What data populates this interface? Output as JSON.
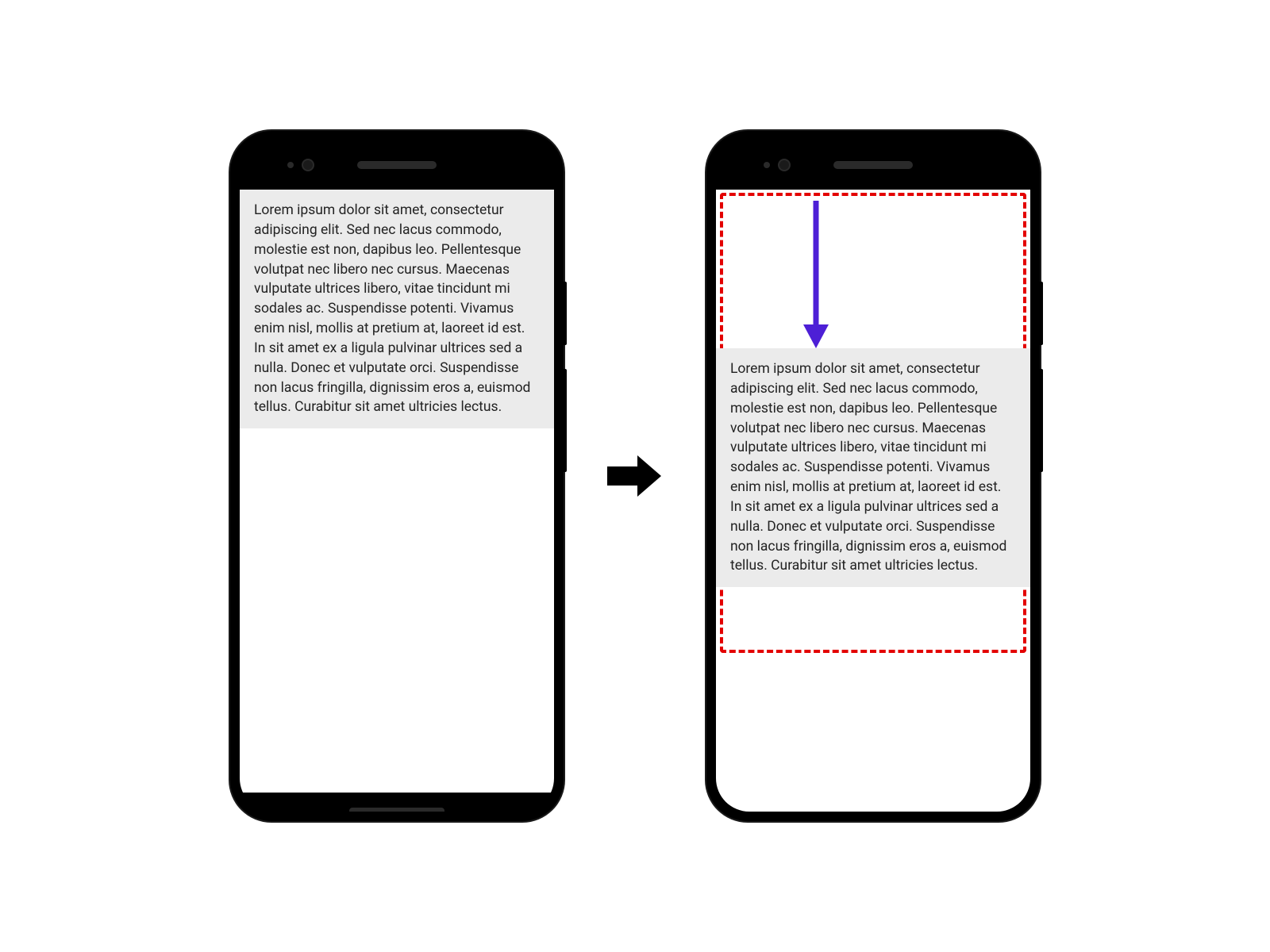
{
  "diagram": {
    "description": "before-after-offset-illustration",
    "lorem_text": "Lorem ipsum dolor sit amet, consectetur adipiscing elit. Sed nec lacus commodo, molestie est non, dapibus leo. Pellentesque volutpat nec libero nec cursus. Maecenas vulputate ultrices libero, vitae tincidunt mi sodales ac. Suspendisse potenti. Vivamus enim nisl, mollis at pretium at, laoreet id est. In sit amet ex a ligula pulvinar ultrices sed a nulla. Donec et vulputate orci. Suspendisse non lacus fringilla, dignissim eros a, euismod tellus. Curabitur sit amet ultricies lectus.",
    "colors": {
      "text_block_bg": "#ebebeb",
      "dashed_border": "#e30000",
      "offset_arrow": "#4d1fd6",
      "transition_arrow": "#000000"
    }
  }
}
